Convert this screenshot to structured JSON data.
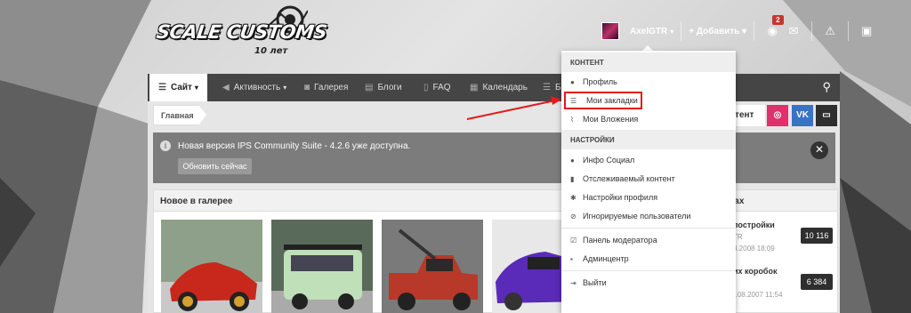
{
  "logo": {
    "title": "SCALE CUSTOMS",
    "subtitle": "10 лет"
  },
  "userbar": {
    "username": "AxelGTR",
    "add_label": "Добавить",
    "notifications_count": "2"
  },
  "nav": {
    "items": [
      {
        "label": "Сайт",
        "icon": "list-icon"
      },
      {
        "label": "Активность",
        "icon": "megaphone-icon"
      },
      {
        "label": "Галерея",
        "icon": "camera-icon"
      },
      {
        "label": "Блоги",
        "icon": "blog-icon"
      },
      {
        "label": "FAQ",
        "icon": "doc-icon"
      },
      {
        "label": "Календарь",
        "icon": "calendar-icon"
      },
      {
        "label": "Бо",
        "icon": "list-icon"
      }
    ]
  },
  "breadcrumb": {
    "home": "Главная"
  },
  "contact_label": "нтент",
  "social": {
    "vk": "VK"
  },
  "notice": {
    "text": "Новая версия IPS Community Suite - 4.2.6 уже доступна.",
    "button": "Обновить сейчас"
  },
  "gallery": {
    "title": "Новое в галерее"
  },
  "side": {
    "title_fragment": "мах",
    "topics": [
      {
        "title": "постройки",
        "meta_user": "TR",
        "meta_date": "3.2008 18:09",
        "count": "10 116"
      },
      {
        "title": "их коробок",
        "meta_user": "",
        "meta_date": "Создано 16.08.2007 11:54",
        "count": "6 384"
      }
    ]
  },
  "dropdown": {
    "content_header": "КОНТЕНТ",
    "content_items": [
      {
        "label": "Профиль",
        "icon": "user-icon"
      },
      {
        "label": "Мои закладки",
        "icon": "bars-icon"
      },
      {
        "label": "Мои Вложения",
        "icon": "paperclip-icon"
      }
    ],
    "settings_header": "НАСТРОЙКИ",
    "settings_items": [
      {
        "label": "Инфо Социал",
        "icon": "users-icon"
      },
      {
        "label": "Отслеживаемый контент",
        "icon": "bookmark-icon"
      },
      {
        "label": "Настройки профиля",
        "icon": "cog-icon"
      },
      {
        "label": "Игнорируемые пользователи",
        "icon": "ban-icon"
      }
    ],
    "admin_items": [
      {
        "label": "Панель модератора",
        "icon": "check-icon"
      },
      {
        "label": "Админцентр",
        "icon": "lock-icon"
      }
    ],
    "logout": {
      "label": "Выйти",
      "icon": "logout-icon"
    }
  },
  "colors": {
    "highlight": "#e21b1b",
    "instagram": "#e1306c",
    "vk": "#3a73c4",
    "nav": "#454545"
  }
}
